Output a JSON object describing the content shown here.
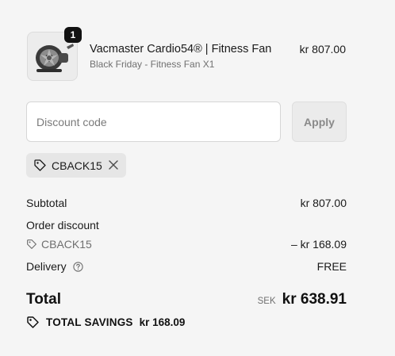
{
  "line_item": {
    "quantity": "1",
    "name": "Vacmaster Cardio54® | Fitness Fan",
    "variant": "Black Friday - Fitness Fan X1",
    "price": "kr 807.00"
  },
  "discount": {
    "placeholder": "Discount code",
    "value": "",
    "apply_label": "Apply",
    "applied_code": "CBACK15"
  },
  "summary": {
    "subtotal_label": "Subtotal",
    "subtotal_value": "kr 807.00",
    "order_discount_label": "Order discount",
    "discount_code": "CBACK15",
    "discount_value": "– kr 168.09",
    "delivery_label": "Delivery",
    "delivery_value": "FREE",
    "total_label": "Total",
    "currency": "SEK",
    "total_value": "kr 638.91",
    "savings_label": "TOTAL SAVINGS",
    "savings_value": "kr 168.09"
  },
  "icons": {
    "product": "fitness-fan-image",
    "tag": "tag-icon",
    "remove": "close-icon",
    "help": "question-circle-icon"
  }
}
